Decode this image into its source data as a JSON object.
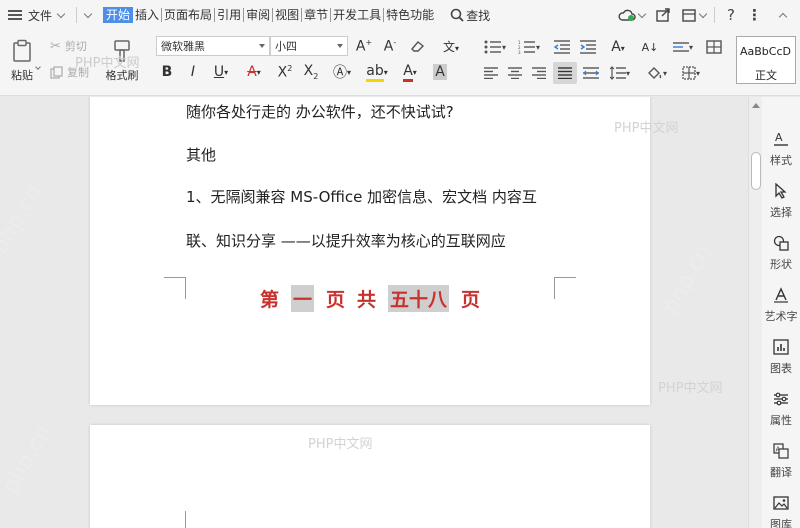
{
  "menubar": {
    "file": "文件",
    "tabs": [
      "开始",
      "插入",
      "页面布局",
      "引用",
      "审阅",
      "视图",
      "章节",
      "开发工具",
      "特色功能"
    ],
    "search": "查找"
  },
  "toolbar": {
    "paste": "粘贴",
    "cut": "剪切",
    "copy": "复制",
    "format_painter": "格式刷",
    "font_name": "微软雅黑",
    "font_size": "小四",
    "style_preview": "AaBbCcD",
    "style_name": "正文"
  },
  "document": {
    "paragraphs": [
      "随你各处行走的 办公软件，还不快试试?",
      "其他",
      "1、无隔阂兼容 MS-Office 加密信息、宏文档  内容互",
      "联、知识分享  ——以提升效率为核心的互联网应"
    ],
    "footer": [
      "第",
      "一",
      "页",
      "共",
      "五十八",
      "页"
    ],
    "watermark": "PHP中文网",
    "watermark_diag": "php.cn"
  },
  "rightpanel": {
    "items": [
      "样式",
      "选择",
      "形状",
      "艺术字",
      "图表",
      "属性",
      "翻译",
      "图库"
    ]
  },
  "colors": {
    "accent": "#4d8fe8",
    "footer_red": "#c9312d"
  }
}
